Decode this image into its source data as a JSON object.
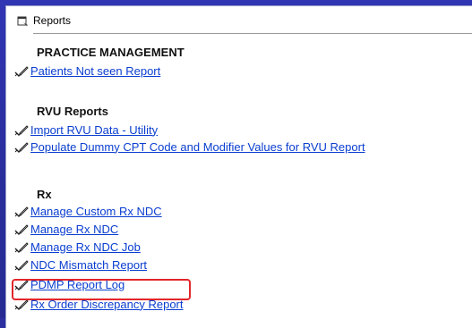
{
  "header": {
    "title": "Reports",
    "icon": "report-folder-icon"
  },
  "sections": [
    {
      "title": "PRACTICE MANAGEMENT",
      "links": [
        {
          "label": "Patients Not seen Report",
          "icon": "pen-check-icon"
        }
      ]
    },
    {
      "title": "RVU Reports",
      "links": [
        {
          "label": "Import RVU Data - Utility",
          "icon": "pen-check-icon"
        },
        {
          "label": "Populate Dummy CPT Code and Modifier Values for RVU Report",
          "icon": "pen-check-icon"
        }
      ]
    },
    {
      "title": "Rx",
      "links": [
        {
          "label": "Manage Custom Rx NDC",
          "icon": "pen-check-icon"
        },
        {
          "label": "Manage Rx NDC",
          "icon": "pen-check-icon"
        },
        {
          "label": "Manage Rx NDC Job",
          "icon": "pen-check-icon"
        },
        {
          "label": "NDC Mismatch Report",
          "icon": "pen-check-icon"
        },
        {
          "label": "PDMP Report Log",
          "icon": "pen-check-icon",
          "highlighted": true
        },
        {
          "label": "Rx Order Discrepancy Report",
          "icon": "pen-check-icon"
        }
      ]
    }
  ],
  "colors": {
    "link": "#0a3ed0",
    "highlight": "#e2262a",
    "background": "#2b2fa0"
  }
}
